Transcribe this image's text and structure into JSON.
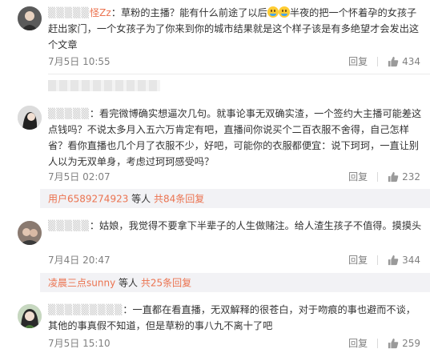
{
  "comments": [
    {
      "user_tail": "怪Zz",
      "text_part1": "：草粉的主播？能有什么前途了以后",
      "text_part2": "半夜的把一个怀着孕的女孩子赶出家门，一个女孩子为了你来到你的城市结果就是这个样子该是有多绝望才会发出这个文章",
      "time": "7月5日 10:55",
      "reply_label": "回复",
      "likes": "434"
    },
    {
      "user_tail": "",
      "text": "：看完微博确实想逼次几句。就事论事无双确实渣，一个签约大主播可能差这点钱吗？不说太多月入五六万肯定有吧，直播间你说买个二百衣服不舍得，自己怎样省？看你直播也几个月了衣服不少，好吧，可能你的衣服都便宜：说下珂珂，一直让别人以为无双单身，考虑过珂珂感受吗？",
      "time": "7月5日 02:07",
      "reply_label": "回复",
      "likes": "232",
      "reply_thread": {
        "user": "用户6589274923",
        "mid": " 等人 ",
        "count": "共84条回复"
      }
    },
    {
      "user_tail": "",
      "text": "：姑娘，我觉得不要拿下半辈子的人生做赌注。给人渣生孩子不值得。摸摸头",
      "time": "7月4日 20:47",
      "reply_label": "回复",
      "likes": "344",
      "reply_thread": {
        "user": "凌晨三点sunny",
        "mid": " 等人 ",
        "count": "共25条回复"
      }
    },
    {
      "user_tail": "",
      "text": "：一直都在看直播，无双解释的很苍白，对于吻痕的事也避而不谈，其他的事真假不知道，但是草粉的事八九不离十了吧",
      "time": "7月5日 15:10",
      "reply_label": "回复",
      "likes": "259"
    }
  ],
  "colors": {
    "username": "#eb7350",
    "meta": "#808080",
    "reply_panel_bg": "#f2f2f5"
  },
  "icons": {
    "like": "thumbs-up-icon",
    "emoji": "crying-laughing-emoji-icon"
  }
}
